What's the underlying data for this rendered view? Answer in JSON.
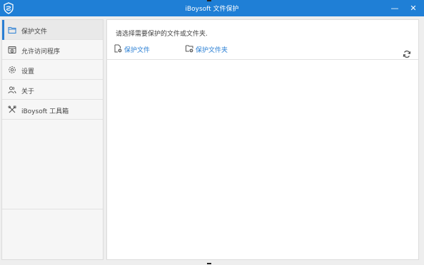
{
  "window": {
    "title": "iBoysoft 文件保护",
    "minimize_glyph": "—",
    "close_glyph": "✕"
  },
  "sidebar": {
    "items": [
      {
        "label": "保护文件",
        "icon": "folder-icon",
        "active": true
      },
      {
        "label": "允许访问程序",
        "icon": "add-app-icon",
        "active": false
      },
      {
        "label": "设置",
        "icon": "gear-icon",
        "active": false
      },
      {
        "label": "关于",
        "icon": "users-icon",
        "active": false
      },
      {
        "label": "iBoysoft 工具箱",
        "icon": "tools-icon",
        "active": false
      }
    ]
  },
  "main": {
    "hint": "请选择需要保护的文件或文件夹.",
    "actions": [
      {
        "label": "保护文件",
        "icon": "add-file-icon"
      },
      {
        "label": "保护文件夹",
        "icon": "add-folder-icon"
      }
    ],
    "refresh_icon": "refresh-icon"
  },
  "colors": {
    "titlebar": "#1f7fd6",
    "accent": "#2a7fd4",
    "sidebar_bg": "#f6f6f6",
    "frame_bg": "#eeeeee"
  }
}
